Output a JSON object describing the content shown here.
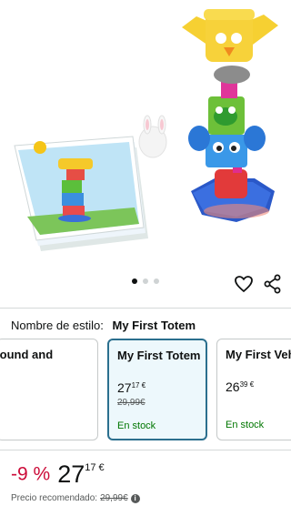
{
  "gallery": {
    "image_alt": "My First Totem stacking toy with puzzle cards",
    "dots_total": 3,
    "dots_active_index": 0
  },
  "actions": {
    "favorite_icon": "heart-icon",
    "share_icon": "share-icon"
  },
  "style_selector": {
    "label": "Nombre de estilo:",
    "selected_value": "My First Totem",
    "options": [
      {
        "title": "Sound and",
        "price_whole": "",
        "price_cents": "",
        "old_price": "",
        "stock": ""
      },
      {
        "title": "My First Totem",
        "price_whole": "27",
        "price_cents": "17 €",
        "old_price": "29,99€",
        "stock": "En stock",
        "selected": true
      },
      {
        "title": "My First Veh",
        "price_whole": "26",
        "price_cents": "39 €",
        "old_price": "",
        "stock": "En stock"
      }
    ]
  },
  "pricing": {
    "discount": "-9 %",
    "price_whole": "27",
    "price_cents": "17 €",
    "rrp_label": "Precio recomendado:",
    "rrp_value": "29,99€"
  },
  "colors": {
    "discount_red": "#cc0c39",
    "stock_green": "#007600",
    "selected_border": "#2b6f8e",
    "selected_bg": "#edf8fc"
  }
}
